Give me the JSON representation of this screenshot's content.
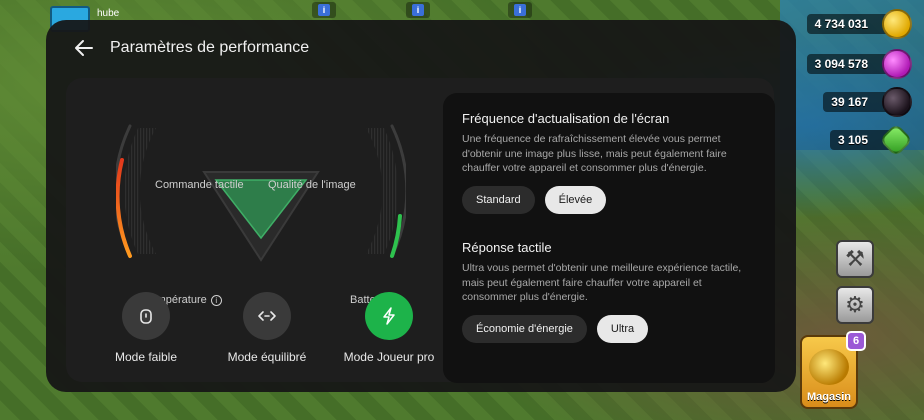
{
  "game": {
    "player_name": "hube",
    "resources": {
      "gold": "4 734 031",
      "elixir": "3 094 578",
      "dark_elixir": "39 167",
      "gems": "3 105"
    },
    "shop": {
      "label": "Magasin",
      "badge": "6"
    }
  },
  "panel": {
    "title": "Paramètres de performance",
    "dial": {
      "touch_label": "Commande tactile",
      "image_label": "Qualité de l'image",
      "temperature_label": "Température",
      "battery_label": "Batterie"
    },
    "modes": [
      {
        "label": "Mode faible",
        "icon": "lock-icon",
        "active": false
      },
      {
        "label": "Mode équilibré",
        "icon": "balance-arrows-icon",
        "active": false
      },
      {
        "label": "Mode Joueur pro",
        "icon": "lightning-icon",
        "active": true
      }
    ],
    "refresh": {
      "title": "Fréquence d'actualisation de l'écran",
      "description": "Une fréquence de rafraîchissement élevée vous permet d'obtenir une image plus lisse, mais peut également faire chauffer votre appareil et consommer plus d'énergie.",
      "options": [
        "Standard",
        "Élevée"
      ],
      "selected": "Élevée"
    },
    "touch": {
      "title": "Réponse tactile",
      "description": "Ultra vous permet d'obtenir une meilleure expérience tactile, mais peut également faire chauffer votre appareil et consommer plus d'énergie.",
      "options": [
        "Économie d'énergie",
        "Ultra"
      ],
      "selected": "Ultra"
    }
  },
  "colors": {
    "accent_green": "#1db34a",
    "temperature_gradient_start": "#ff9a1f",
    "temperature_gradient_end": "#e2381c",
    "battery_green": "#2ec24e"
  }
}
